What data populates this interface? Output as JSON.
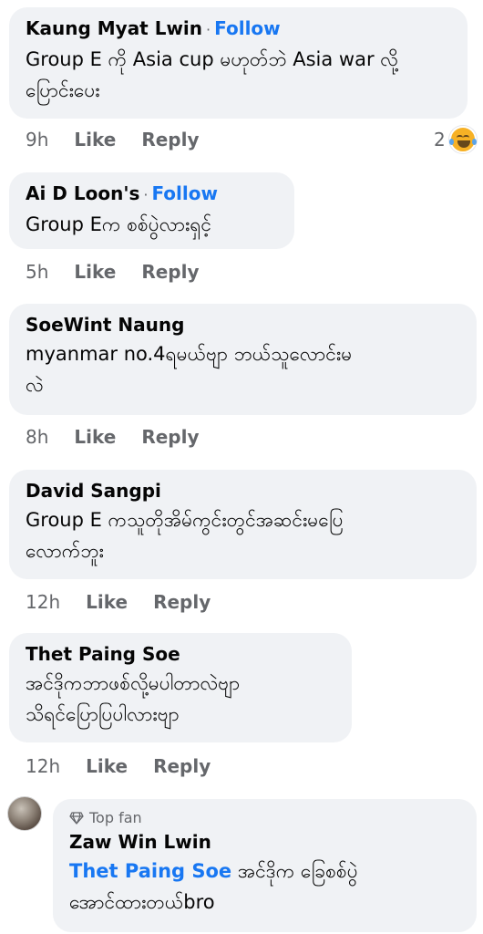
{
  "comments": [
    {
      "author": "Kaung Myat Lwin",
      "follow": "Follow",
      "text_lines": [
        "Group E ကို Asia cup မဟုတ်ဘဲ Asia war လို့",
        "ပြောင်းပေး"
      ],
      "time": "9h",
      "like": "Like",
      "reply": "Reply",
      "reaction_count": "2",
      "reaction_icon": "laughing-emoji-icon"
    },
    {
      "author": "Ai D Loon's",
      "follow": "Follow",
      "text_lines": [
        "Group Eက စစ်ပွဲလားရှင့်"
      ],
      "time": "5h",
      "like": "Like",
      "reply": "Reply"
    },
    {
      "author": "SoeWint Naung",
      "text_lines": [
        "myanmar no.4ရမယ်ဗျာ ဘယ်သူလောင်းမ",
        "လဲ"
      ],
      "time": "8h",
      "like": "Like",
      "reply": "Reply"
    },
    {
      "author": "David Sangpi",
      "text_lines": [
        "Group E ကသူတိုအိမ်ကွင်းတွင်အဆင်းမပြေ",
        "လောက်ဘူး"
      ],
      "time": "12h",
      "like": "Like",
      "reply": "Reply"
    },
    {
      "author": "Thet Paing Soe",
      "text_lines": [
        "အင်ဒိုကဘာဖစ်လို့မပါတာလဲဗျာ",
        "သိရင်ပြောပြပါလားဗျာ"
      ],
      "time": "12h",
      "like": "Like",
      "reply": "Reply"
    }
  ],
  "reply": {
    "badge": "Top fan",
    "badge_icon": "diamond-icon",
    "author": "Zaw Win Lwin",
    "mention": "Thet Paing Soe",
    "text_first": " အင်ဒိုက ခြေစစ်ပွဲ",
    "text_second": "အောင်ထားတယ်bro"
  }
}
